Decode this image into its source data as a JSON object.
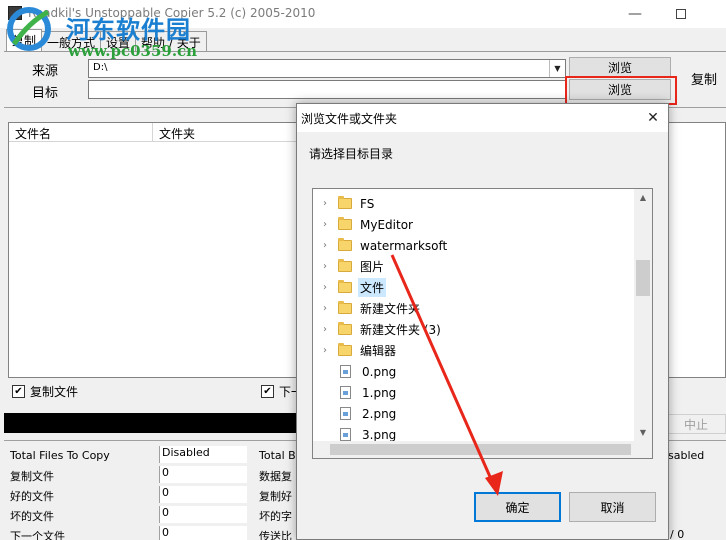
{
  "window": {
    "title": "Roadkil's Unstoppable Copier 5.2 (c) 2005-2010",
    "min_glyph": "—",
    "watermark_text": "河东软件园",
    "watermark_url": "www.pc0359.cn"
  },
  "tabs": [
    {
      "label": "复制"
    },
    {
      "label": "一般方式"
    },
    {
      "label": "设置"
    },
    {
      "label": "帮助 / 关于"
    }
  ],
  "source": {
    "label": "来源",
    "value": "D:\\",
    "arrow": "▼"
  },
  "target": {
    "label": "目标",
    "value": ""
  },
  "buttons": {
    "browse_source": "浏览",
    "browse_target": "浏览",
    "copy": "复制",
    "stop": "中止"
  },
  "file_list": {
    "columns": [
      "文件名",
      "文件夹"
    ]
  },
  "options": {
    "copy_files": {
      "label": "复制文件",
      "checked": true
    },
    "next": {
      "label": "下一",
      "checked": true
    }
  },
  "stats": {
    "left": [
      {
        "label": "Total Files To Copy",
        "value": "Disabled"
      },
      {
        "label": "复制文件",
        "value": "0"
      },
      {
        "label": "好的文件",
        "value": "0"
      },
      {
        "label": "坏的文件",
        "value": "0"
      },
      {
        "label": "下一个文件",
        "value": "0"
      }
    ],
    "middle": [
      {
        "label": "Total By"
      },
      {
        "label": "数据复"
      },
      {
        "label": "复制好"
      },
      {
        "label": "坏的字"
      },
      {
        "label": "传送比"
      }
    ],
    "right_value": "sabled",
    "right_bottom": "/ 0"
  },
  "dialog": {
    "title": "浏览文件或文件夹",
    "prompt": "请选择目标目录",
    "close_glyph": "✕",
    "tree": [
      {
        "name": "FS",
        "type": "folder",
        "expandable": true,
        "selected": false
      },
      {
        "name": "MyEditor",
        "type": "folder",
        "expandable": true,
        "selected": false
      },
      {
        "name": "watermarksoft",
        "type": "folder",
        "expandable": true,
        "selected": false
      },
      {
        "name": "图片",
        "type": "folder",
        "expandable": true,
        "selected": false
      },
      {
        "name": "文件",
        "type": "folder",
        "expandable": true,
        "selected": true
      },
      {
        "name": "新建文件夹",
        "type": "folder",
        "expandable": true,
        "selected": false
      },
      {
        "name": "新建文件夹 (3)",
        "type": "folder",
        "expandable": true,
        "selected": false
      },
      {
        "name": "编辑器",
        "type": "folder",
        "expandable": true,
        "selected": false
      },
      {
        "name": "0.png",
        "type": "file",
        "expandable": false,
        "selected": false
      },
      {
        "name": "1.png",
        "type": "file",
        "expandable": false,
        "selected": false
      },
      {
        "name": "2.png",
        "type": "file",
        "expandable": false,
        "selected": false
      },
      {
        "name": "3.png",
        "type": "file",
        "expandable": false,
        "selected": false
      }
    ],
    "ok": "确定",
    "cancel": "取消",
    "scroll_up": "▲",
    "scroll_down": "▼"
  },
  "colors": {
    "annotation": "#e8261a",
    "accent": "#0078d7",
    "selection": "#cce8ff"
  }
}
